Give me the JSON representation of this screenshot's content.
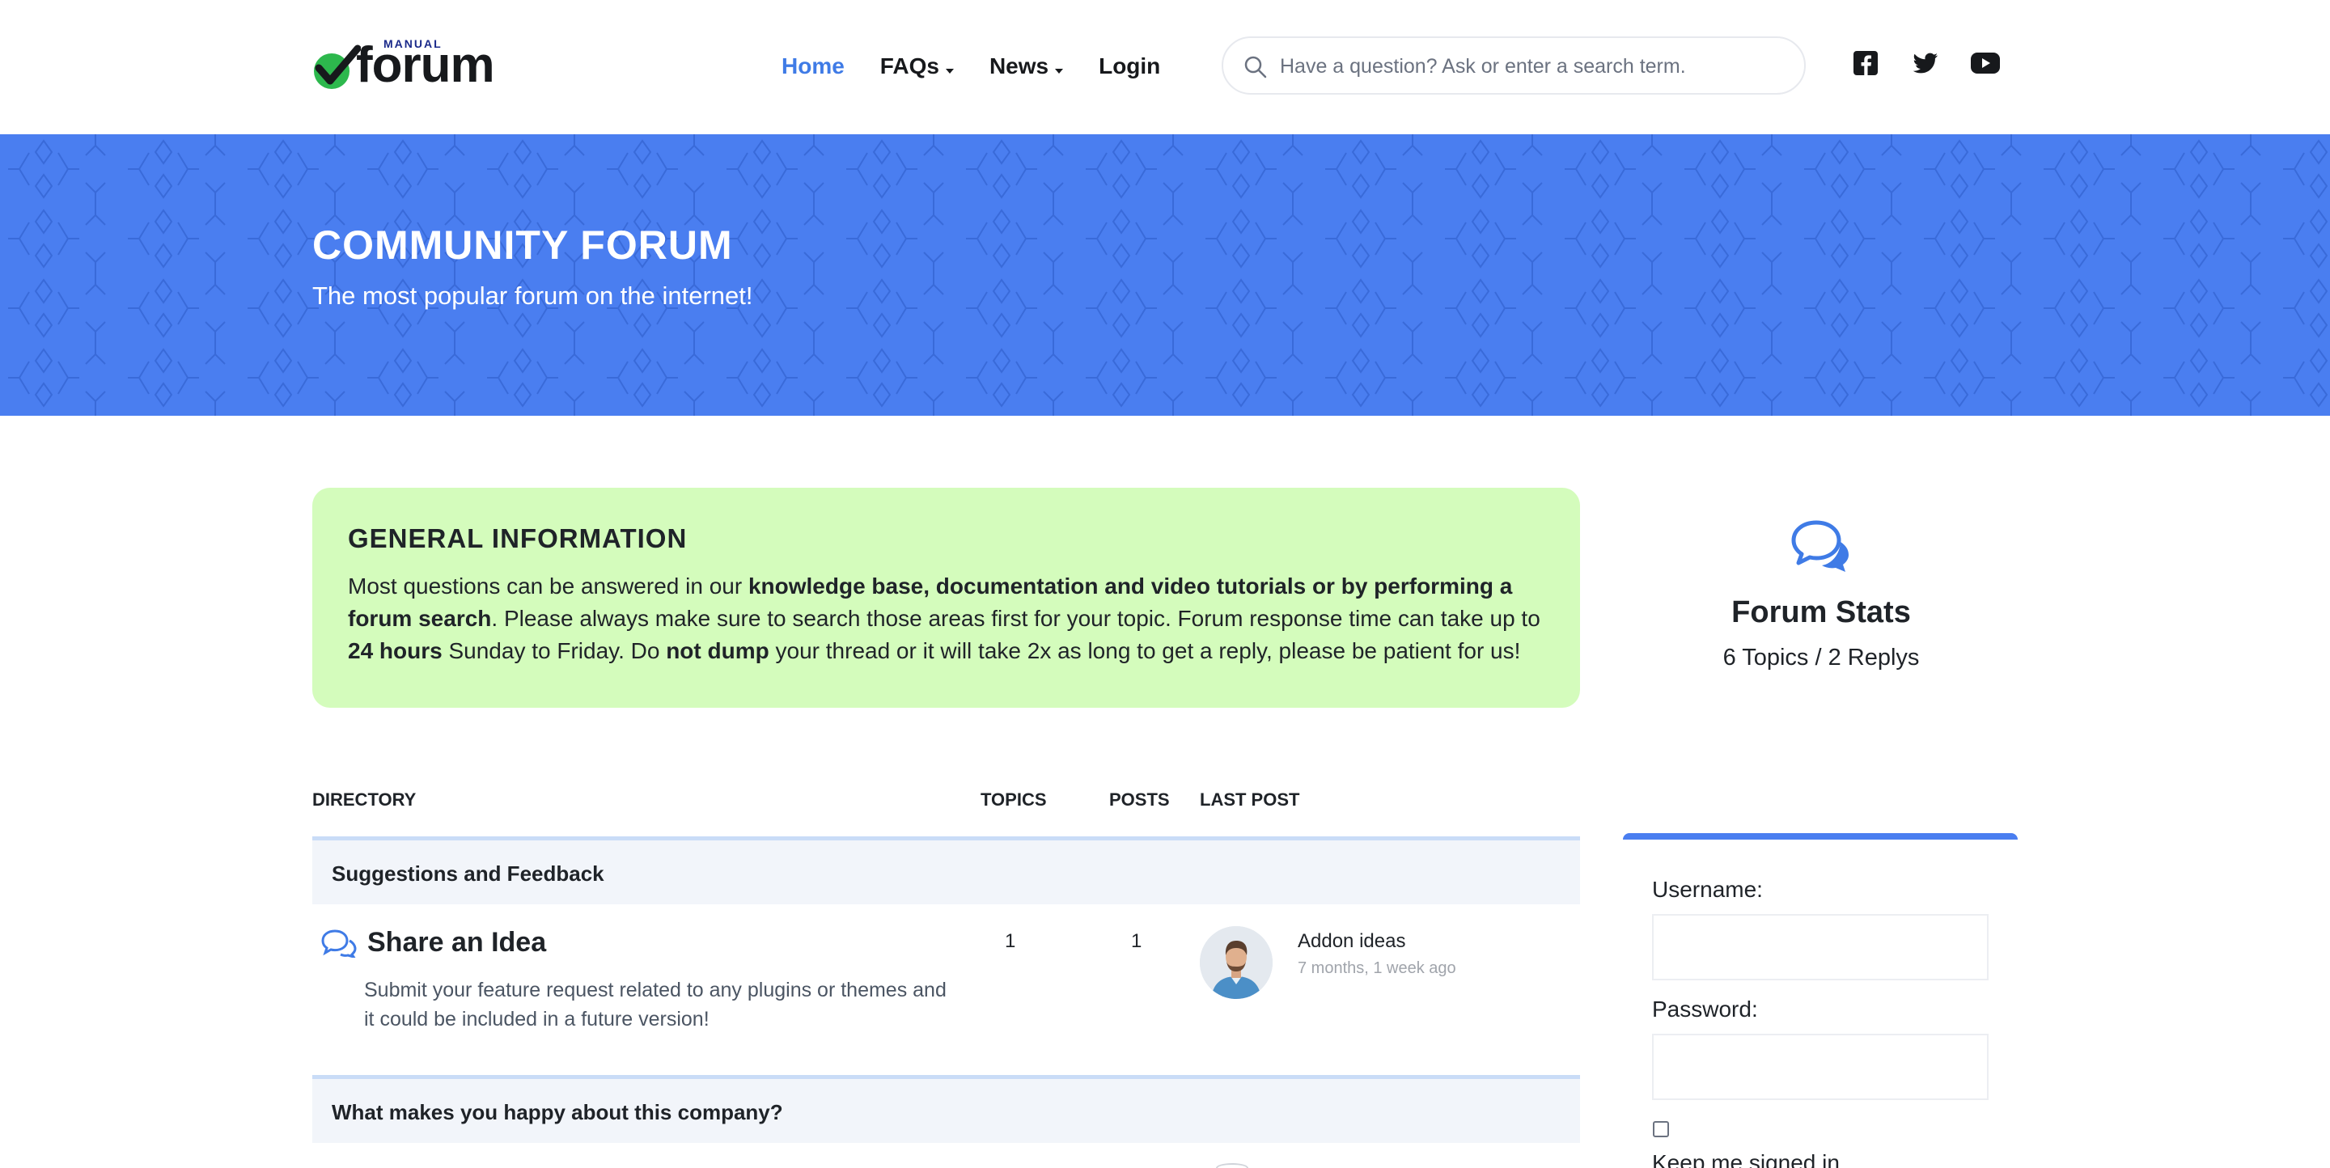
{
  "header": {
    "logo": {
      "small": "MANUAL",
      "main": "forum"
    },
    "nav": [
      {
        "label": "Home",
        "active": true,
        "dropdown": false
      },
      {
        "label": "FAQs",
        "active": false,
        "dropdown": true
      },
      {
        "label": "News",
        "active": false,
        "dropdown": true
      },
      {
        "label": "Login",
        "active": false,
        "dropdown": false
      }
    ],
    "search": {
      "placeholder": "Have a question? Ask or enter a search term.",
      "value": ""
    },
    "social": [
      "facebook-icon",
      "twitter-icon",
      "youtube-icon"
    ]
  },
  "hero": {
    "title": "COMMUNITY FORUM",
    "subtitle": "The most popular forum on the internet!",
    "color": "#4a7ef0"
  },
  "info": {
    "title": "GENERAL INFORMATION",
    "t1": "Most questions can be answered in our ",
    "b1": "knowledge base, documentation and video tutorials or by performing a forum search",
    "t2": ". Please always make sure to search those areas first for your topic. Forum response time can take up to ",
    "b2": "24 hours",
    "t3": " Sunday to Friday. Do ",
    "b3": "not dump",
    "t4": " your thread or it will take 2x as long to get a reply, please be patient for us!",
    "background": "#d4fcbc"
  },
  "stats": {
    "title": "Forum Stats",
    "summary": "6 Topics / 2 Replys"
  },
  "directory": {
    "headers": {
      "directory": "DIRECTORY",
      "topics": "TOPICS",
      "posts": "POSTS",
      "last_post": "LAST POST"
    },
    "categories": [
      {
        "label": "Suggestions and Feedback",
        "forums": [
          {
            "title": "Share an Idea",
            "description": "Submit your feature request related to any plugins or themes and it could be included in a future version!",
            "topics": "1",
            "posts": "1",
            "last_post_title": "Addon ideas",
            "last_post_time": "7 months, 1 week ago"
          }
        ]
      },
      {
        "label": "What makes you happy about this company?",
        "forums": []
      }
    ]
  },
  "login": {
    "username_label": "Username:",
    "password_label": "Password:",
    "remember_label": "Keep me signed in",
    "accent": "#4a7ef0"
  }
}
